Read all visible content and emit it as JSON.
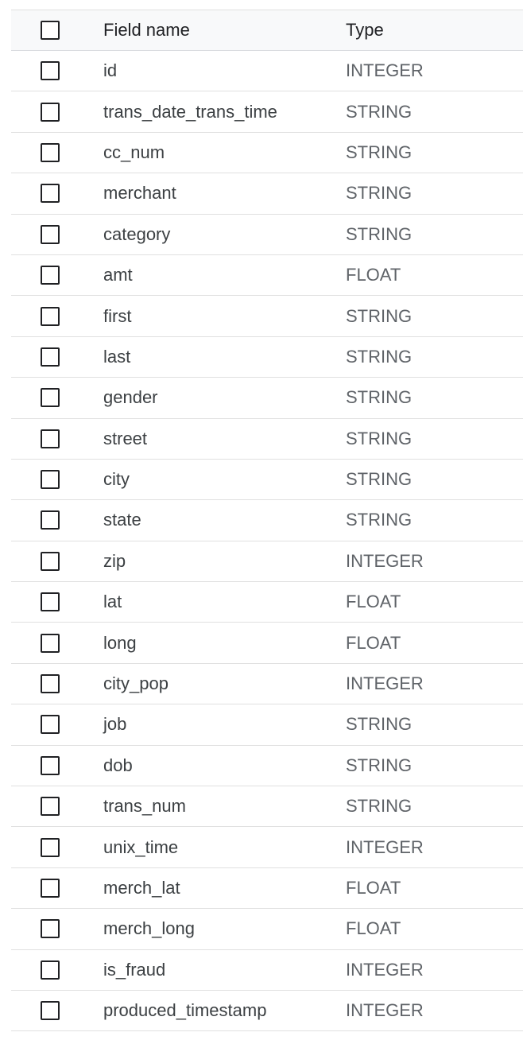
{
  "header": {
    "field_name_label": "Field name",
    "type_label": "Type"
  },
  "rows": [
    {
      "name": "id",
      "type": "INTEGER"
    },
    {
      "name": "trans_date_trans_time",
      "type": "STRING"
    },
    {
      "name": "cc_num",
      "type": "STRING"
    },
    {
      "name": "merchant",
      "type": "STRING"
    },
    {
      "name": "category",
      "type": "STRING"
    },
    {
      "name": "amt",
      "type": "FLOAT"
    },
    {
      "name": "first",
      "type": "STRING"
    },
    {
      "name": "last",
      "type": "STRING"
    },
    {
      "name": "gender",
      "type": "STRING"
    },
    {
      "name": "street",
      "type": "STRING"
    },
    {
      "name": "city",
      "type": "STRING"
    },
    {
      "name": "state",
      "type": "STRING"
    },
    {
      "name": "zip",
      "type": "INTEGER"
    },
    {
      "name": "lat",
      "type": "FLOAT"
    },
    {
      "name": "long",
      "type": "FLOAT"
    },
    {
      "name": "city_pop",
      "type": "INTEGER"
    },
    {
      "name": "job",
      "type": "STRING"
    },
    {
      "name": "dob",
      "type": "STRING"
    },
    {
      "name": "trans_num",
      "type": "STRING"
    },
    {
      "name": "unix_time",
      "type": "INTEGER"
    },
    {
      "name": "merch_lat",
      "type": "FLOAT"
    },
    {
      "name": "merch_long",
      "type": "FLOAT"
    },
    {
      "name": "is_fraud",
      "type": "INTEGER"
    },
    {
      "name": "produced_timestamp",
      "type": "INTEGER"
    }
  ]
}
